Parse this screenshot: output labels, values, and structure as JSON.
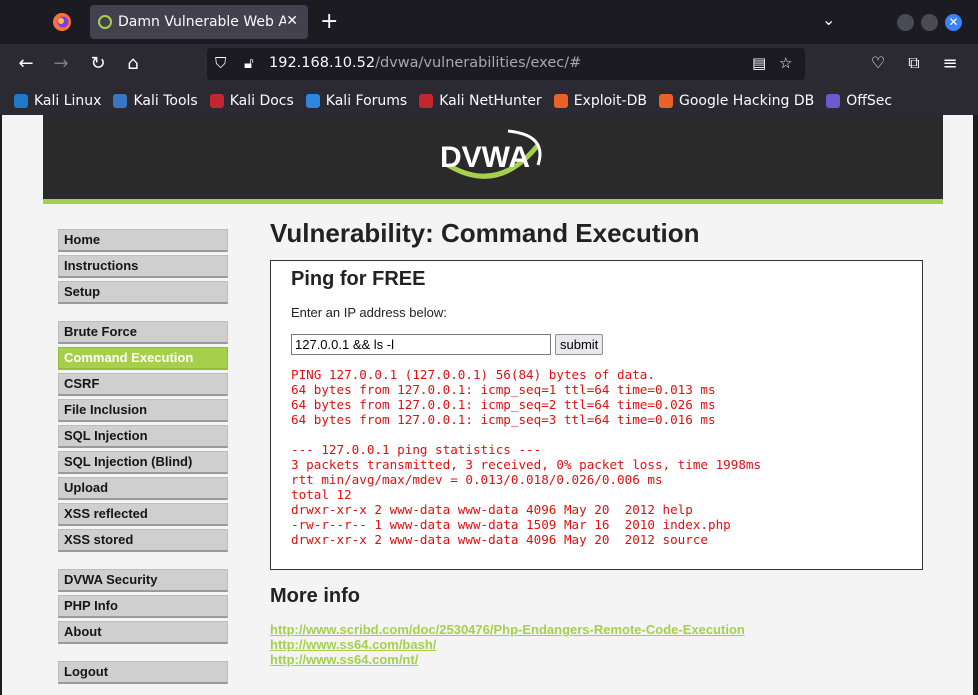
{
  "browser": {
    "tab_title": "Damn Vulnerable Web App",
    "url_host": "192.168.10.52",
    "url_path": "/dvwa/vulnerabilities/exec/#",
    "bookmarks": [
      {
        "label": "Kali Linux",
        "color": "#1f78c8"
      },
      {
        "label": "Kali Tools",
        "color": "#3a76c4"
      },
      {
        "label": "Kali Docs",
        "color": "#c4262e"
      },
      {
        "label": "Kali Forums",
        "color": "#2e86de"
      },
      {
        "label": "Kali NetHunter",
        "color": "#c4262e"
      },
      {
        "label": "Exploit-DB",
        "color": "#e8622a"
      },
      {
        "label": "Google Hacking DB",
        "color": "#e8622a"
      },
      {
        "label": "OffSec",
        "color": "#6a5acd"
      }
    ]
  },
  "logo": {
    "text": "DVWA"
  },
  "menu": {
    "groups": [
      [
        {
          "label": "Home"
        },
        {
          "label": "Instructions"
        },
        {
          "label": "Setup"
        }
      ],
      [
        {
          "label": "Brute Force"
        },
        {
          "label": "Command Execution",
          "active": true
        },
        {
          "label": "CSRF"
        },
        {
          "label": "File Inclusion"
        },
        {
          "label": "SQL Injection"
        },
        {
          "label": "SQL Injection (Blind)"
        },
        {
          "label": "Upload"
        },
        {
          "label": "XSS reflected"
        },
        {
          "label": "XSS stored"
        }
      ],
      [
        {
          "label": "DVWA Security"
        },
        {
          "label": "PHP Info"
        },
        {
          "label": "About"
        }
      ],
      [
        {
          "label": "Logout"
        }
      ]
    ]
  },
  "main": {
    "title": "Vulnerability: Command Execution",
    "box_title": "Ping for FREE",
    "prompt": "Enter an IP address below:",
    "input_value": "127.0.0.1 && ls -l",
    "submit_label": "submit",
    "output": "PING 127.0.0.1 (127.0.0.1) 56(84) bytes of data.\n64 bytes from 127.0.0.1: icmp_seq=1 ttl=64 time=0.013 ms\n64 bytes from 127.0.0.1: icmp_seq=2 ttl=64 time=0.026 ms\n64 bytes from 127.0.0.1: icmp_seq=3 ttl=64 time=0.016 ms\n\n--- 127.0.0.1 ping statistics ---\n3 packets transmitted, 3 received, 0% packet loss, time 1998ms\nrtt min/avg/max/mdev = 0.013/0.018/0.026/0.006 ms\ntotal 12\ndrwxr-xr-x 2 www-data www-data 4096 May 20  2012 help\n-rw-r--r-- 1 www-data www-data 1509 Mar 16  2010 index.php\ndrwxr-xr-x 2 www-data www-data 4096 May 20  2012 source",
    "more_info_title": "More info",
    "links": [
      "http://www.scribd.com/doc/2530476/Php-Endangers-Remote-Code-Execution",
      "http://www.ss64.com/bash/",
      "http://www.ss64.com/nt/"
    ]
  }
}
